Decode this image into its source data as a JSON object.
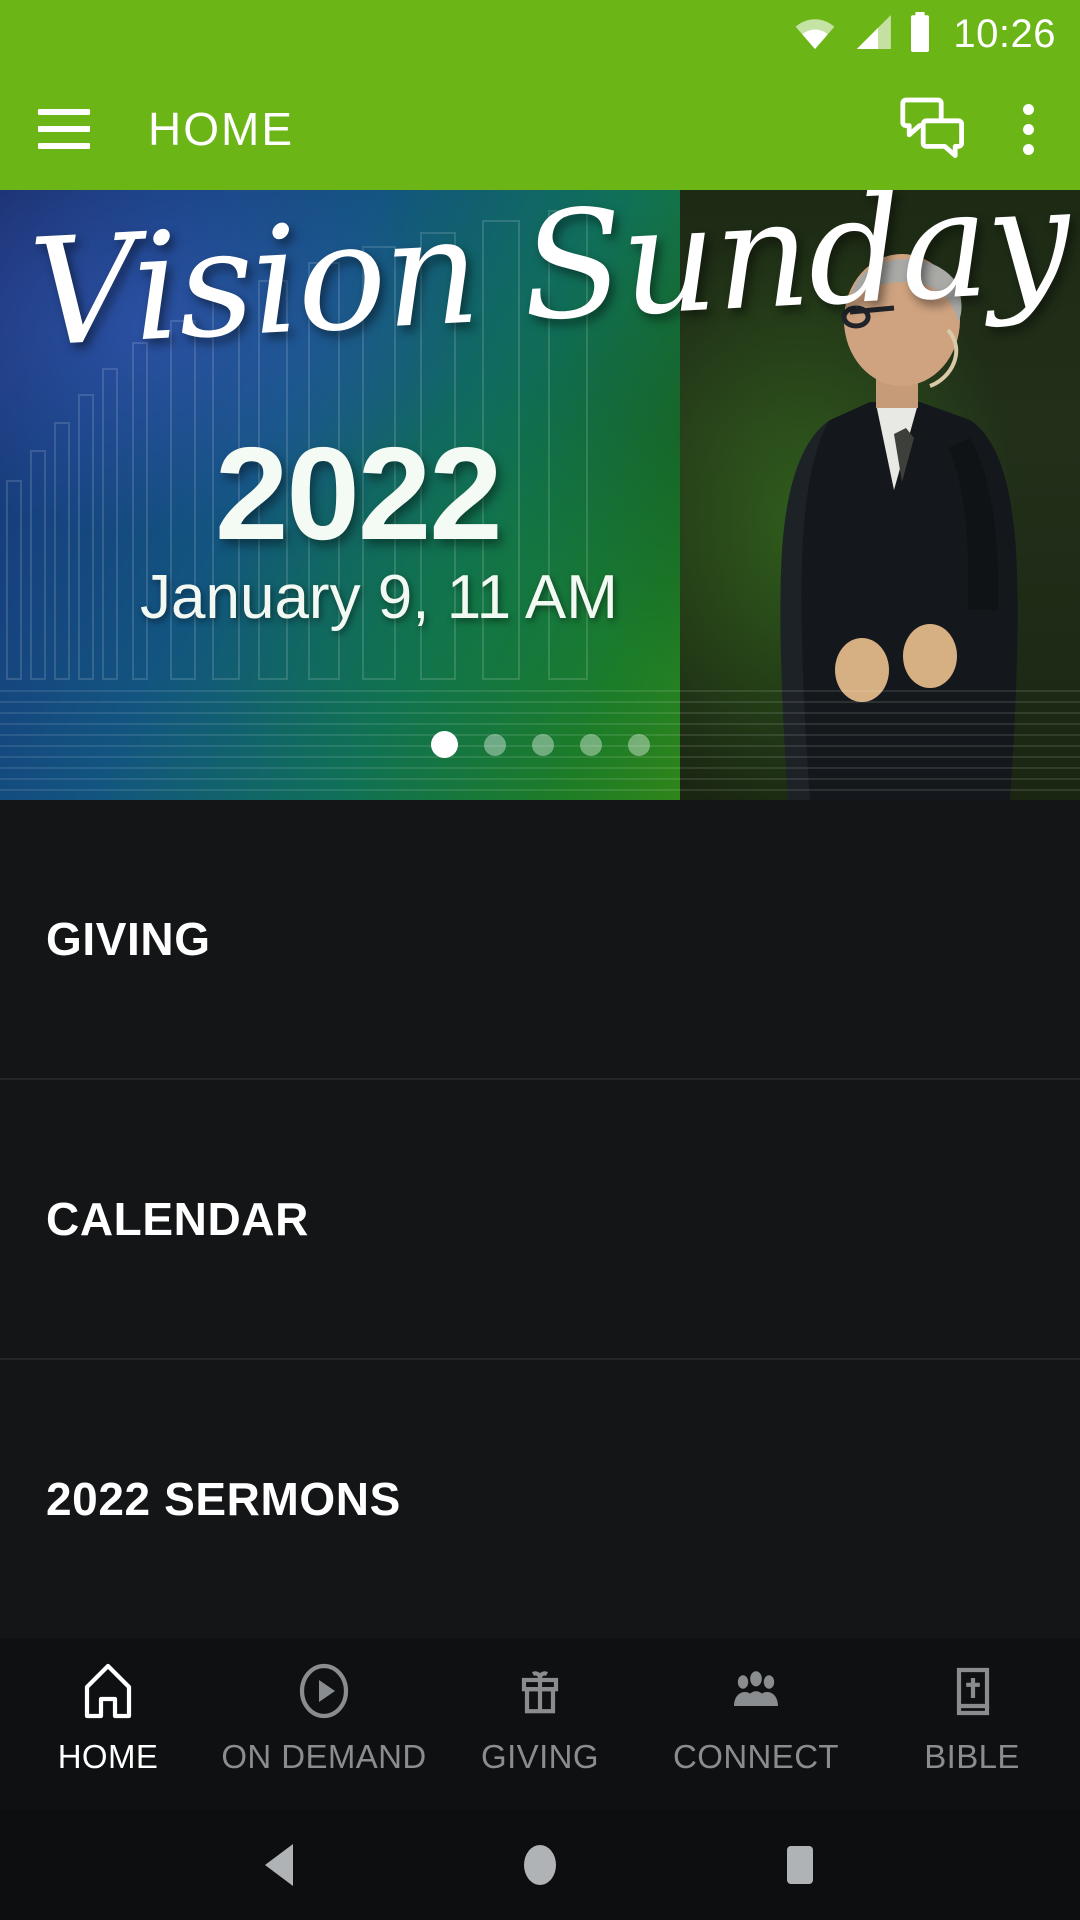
{
  "status_bar": {
    "time": "10:26",
    "icons": [
      "wifi-icon",
      "cell-signal-icon",
      "battery-icon"
    ]
  },
  "app_bar": {
    "menu_icon": "hamburger-menu-icon",
    "title": "HOME",
    "chat_icon": "chat-bubbles-icon",
    "overflow_icon": "more-vertical-icon",
    "background_color": "#6BB517"
  },
  "hero": {
    "script_title": "Vision Sunday",
    "year": "2022",
    "date_time": "January 9, 11 AM",
    "carousel": {
      "total": 5,
      "active_index": 0
    },
    "gradient_from": "#1b2f6e",
    "gradient_to": "#5a9a0d"
  },
  "list": {
    "items": [
      {
        "label": "GIVING"
      },
      {
        "label": "CALENDAR"
      },
      {
        "label": "2022 SERMONS"
      }
    ]
  },
  "tab_bar": {
    "active_index": 0,
    "tabs": [
      {
        "label": "HOME",
        "icon": "home-church-icon"
      },
      {
        "label": "ON DEMAND",
        "icon": "play-circle-icon"
      },
      {
        "label": "GIVING",
        "icon": "gift-icon"
      },
      {
        "label": "CONNECT",
        "icon": "people-group-icon"
      },
      {
        "label": "BIBLE",
        "icon": "bible-cross-icon"
      }
    ],
    "active_color": "#ffffff",
    "inactive_color": "#8a8d90"
  },
  "system_nav": {
    "buttons": [
      {
        "name": "back-button",
        "icon": "triangle-back-icon"
      },
      {
        "name": "home-button",
        "icon": "circle-home-icon"
      },
      {
        "name": "recents-button",
        "icon": "square-recents-icon"
      }
    ]
  }
}
